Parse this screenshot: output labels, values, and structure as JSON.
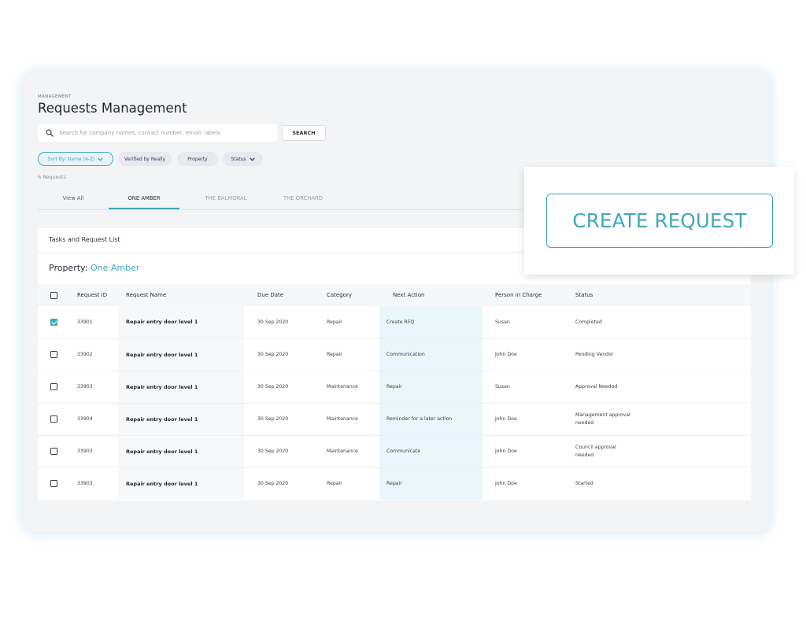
{
  "header": {
    "eyebrow": "MANAGEMENT",
    "title": "Requests Management"
  },
  "search": {
    "placeholder": "Search for company names, contact number, email, labels",
    "value": "",
    "button_label": "SEARCH"
  },
  "filters": {
    "sort_label": "Sort By: Name (A-Z)",
    "chips": [
      "Verified by Really",
      "Property",
      "Status"
    ]
  },
  "count_text": "6 Requests",
  "tabs": [
    {
      "label": "View All"
    },
    {
      "label": "ONE AMBER"
    },
    {
      "label": "THE BALMORAL"
    },
    {
      "label": "THE ORCHARD"
    }
  ],
  "active_tab": "ONE AMBER",
  "list": {
    "title": "Tasks and Request List",
    "property_label": "Property:",
    "property_name": "One Amber"
  },
  "table": {
    "columns": [
      "Request ID",
      "Request Name",
      "Due Date",
      "Category",
      "Next Action",
      "Person in Charge",
      "Status"
    ],
    "rows": [
      {
        "checked": true,
        "id": "33901",
        "name": "Repair entry door level 1",
        "due": "30 Sep 2020",
        "category": "Repair",
        "next_action": "Create RFQ",
        "person": "Susan",
        "status": "Completed"
      },
      {
        "checked": false,
        "id": "33902",
        "name": "Repair entry door level 1",
        "due": "30 Sep 2020",
        "category": "Repair",
        "next_action": "Communication",
        "person": "John Doe",
        "status": "Pending Vendor"
      },
      {
        "checked": false,
        "id": "33903",
        "name": "Repair entry door level 1",
        "due": "30 Sep 2020",
        "category": "Maintenance",
        "next_action": "Repair",
        "person": "Susan",
        "status": "Approval Needed"
      },
      {
        "checked": false,
        "id": "33904",
        "name": "Repair entry door level 1",
        "due": "30 Sep 2020",
        "category": "Maintenance",
        "next_action": "Reminder for a later action",
        "person": "John Doe",
        "status": "Management approval needed"
      },
      {
        "checked": false,
        "id": "33903",
        "name": "Repair entry door level 1",
        "due": "30 Sep 2020",
        "category": "Maintenance",
        "next_action": "Communicate",
        "person": "John Doe",
        "status": "Council approval needed"
      },
      {
        "checked": false,
        "id": "33903",
        "name": "Repair entry door level 1",
        "due": "30 Sep 2020",
        "category": "Repair",
        "next_action": "Repair",
        "person": "John Doe",
        "status": "Started"
      }
    ]
  },
  "cta": {
    "label": "CREATE REQUEST"
  },
  "colors": {
    "accent": "#41a7bd",
    "card_background": "#f2f4f6",
    "next_action_highlight": "#e9f6fa"
  },
  "icons": {
    "search": "search-icon",
    "dropdown": "chevron-down-icon",
    "checkbox": "checkbox-icon"
  }
}
